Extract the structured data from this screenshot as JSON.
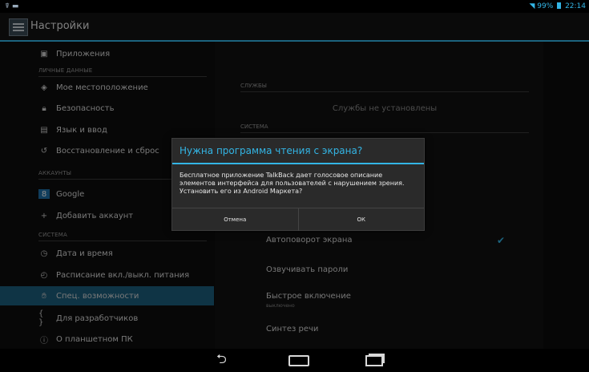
{
  "status_bar": {
    "time": "22:14",
    "battery": "99%"
  },
  "header": {
    "title": "Настройки"
  },
  "sidebar": {
    "items": [
      {
        "label": "Приложения",
        "icon": "apps-icon",
        "selected": false
      },
      {
        "section": "ЛИЧНЫЕ ДАННЫЕ"
      },
      {
        "label": "Мое местоположение",
        "icon": "location-icon",
        "selected": false
      },
      {
        "label": "Безопасность",
        "icon": "lock-icon",
        "selected": false
      },
      {
        "label": "Язык и ввод",
        "icon": "language-icon",
        "selected": false
      },
      {
        "label": "Восстановление и сброс",
        "icon": "restore-icon",
        "selected": false
      },
      {
        "section": "АККАУНТЫ"
      },
      {
        "label": "Google",
        "icon": "google-icon",
        "selected": false
      },
      {
        "label": "Добавить аккаунт",
        "icon": "plus-icon",
        "selected": false
      },
      {
        "section": "СИСТЕМА"
      },
      {
        "label": "Дата и время",
        "icon": "clock-icon",
        "selected": false
      },
      {
        "label": "Расписание вкл./выкл. питания",
        "icon": "power-schedule-icon",
        "selected": false
      },
      {
        "label": "Спец. возможности",
        "icon": "accessibility-icon",
        "selected": true
      },
      {
        "label": "Для разработчиков",
        "icon": "braces-icon",
        "selected": false
      },
      {
        "label": "О планшетном ПК",
        "icon": "info-icon",
        "selected": false
      }
    ]
  },
  "right": {
    "services_header": "СЛУЖБЫ",
    "no_services": "Службы не установлены",
    "system_header": "СИСТЕМА",
    "auto_rotate": "Автоповорот экрана",
    "speak_passwords": "Озвучивать пароли",
    "quick_start": "Быстрое включение",
    "quick_start_sub": "выключено",
    "tts": "Синтез речи"
  },
  "dialog": {
    "title": "Нужна программа чтения с экрана?",
    "message": "Бесплатное приложение TalkBack дает голосовое описание элементов интерфейса для пользователей с нарушением зрения. Установить его из Android Маркета?",
    "cancel": "Отмена",
    "ok": "ОК"
  },
  "colors": {
    "accent": "#33b5e5",
    "selected": "#1d5f7e"
  }
}
